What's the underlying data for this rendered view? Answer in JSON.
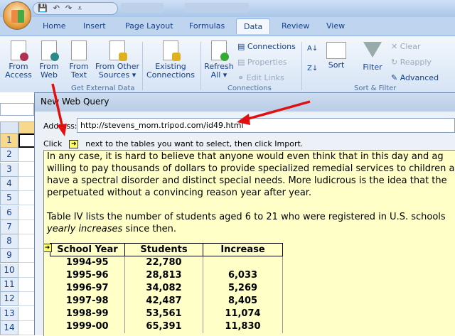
{
  "titlebar": {
    "qat": [
      "save",
      "undo",
      "redo"
    ]
  },
  "tabs": [
    "Home",
    "Insert",
    "Page Layout",
    "Formulas",
    "Data",
    "Review",
    "View"
  ],
  "active_tab": "Data",
  "ribbon": {
    "get_external": [
      {
        "l1": "From",
        "l2": "Access"
      },
      {
        "l1": "From",
        "l2": "Web"
      },
      {
        "l1": "From",
        "l2": "Text"
      },
      {
        "l1": "From Other",
        "l2": "Sources ▾"
      },
      {
        "l1": "Existing",
        "l2": "Connections"
      }
    ],
    "refresh": {
      "l1": "Refresh",
      "l2": "All ▾"
    },
    "connections": [
      "Connections",
      "Properties",
      "Edit Links"
    ],
    "sort": "Sort",
    "filter": "Filter",
    "filter_items": [
      "Clear",
      "Reapply",
      "Advanced"
    ],
    "groups": [
      "Get External Data",
      "Connections",
      "Sort & Filter"
    ]
  },
  "sheet": {
    "rows": [
      "1",
      "2",
      "3",
      "4",
      "5",
      "6",
      "7",
      "8",
      "9",
      "10",
      "11",
      "12",
      "13",
      "14"
    ]
  },
  "dialog": {
    "title": "New Web Query",
    "address_label": "Address:",
    "address": "http://stevens_mom.tripod.com/id49.html",
    "click_before": "Click",
    "click_after": "next to the tables you want to select, then click Import.",
    "paragraphs": [
      "In any case, it is hard to believe that anyone would even think that in this day and ag",
      "willing to pay thousands of dollars to provide specialized remedial services to children a",
      "have a spectral disorder and distinct special needs.  More ludicrous is the idea that the",
      "perpetuated without a convincing reason year after year."
    ],
    "para2": "Table IV lists the number of students aged 6 to 21 who were registered in U.S. schools",
    "para3_italic": "yearly increases",
    "para3_rest": " since then.",
    "table": {
      "headers": [
        "School Year",
        "Students",
        "Increase"
      ],
      "rows": [
        [
          "1994-95",
          "22,780",
          ""
        ],
        [
          "1995-96",
          "28,813",
          "6,033"
        ],
        [
          "1996-97",
          "34,082",
          "5,269"
        ],
        [
          "1997-98",
          "42,487",
          "8,405"
        ],
        [
          "1998-99",
          "53,561",
          "11,074"
        ],
        [
          "1999-00",
          "65,391",
          "11,830"
        ]
      ]
    }
  },
  "colors": {
    "annotation": "#e01010",
    "content_bg": "#ffffc8",
    "ribbon": "#dbe7f6"
  }
}
